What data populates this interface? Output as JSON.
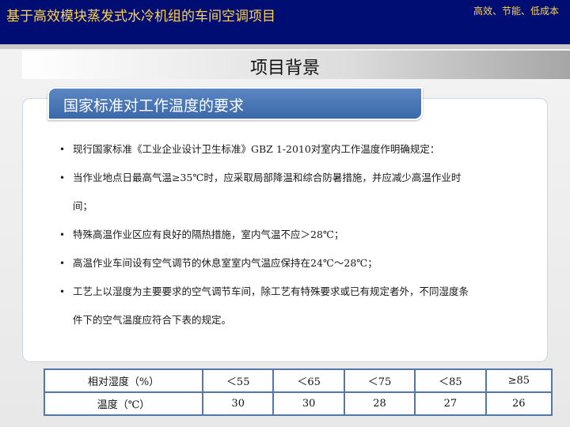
{
  "header": {
    "left_title": "基于高效模块蒸发式水冷机组的车间空调项目",
    "right_title": "高效、节能、低成本"
  },
  "page_title": "项目背景",
  "section_title": "国家标准对工作温度的要求",
  "bullets": [
    "现行国家标准《工业企业设计卫生标准》GBZ 1-2010对室内工作温度作明确规定：",
    "当作业地点日最高气温≥35℃时，应采取局部降温和综合防暑措施，并应减少高温作业时间；",
    "特殊高温作业区应有良好的隔热措施，室内气温不应＞28℃；",
    "高温作业车间设有空气调节的休息室室内气温应保持在24℃～28℃；",
    "工艺上以湿度为主要要求的空气调节车间，除工艺有特殊要求或已有规定者外，不同湿度条件下的空气温度应符合下表的规定。"
  ],
  "bullet_marker": "•",
  "table": {
    "humidity_label": "相对湿度（%）",
    "temp_label": "温度（℃）",
    "humidity": [
      "＜55",
      "＜65",
      "＜75",
      "＜85",
      "≥85"
    ],
    "temp": [
      "30",
      "30",
      "28",
      "27",
      "26"
    ]
  }
}
